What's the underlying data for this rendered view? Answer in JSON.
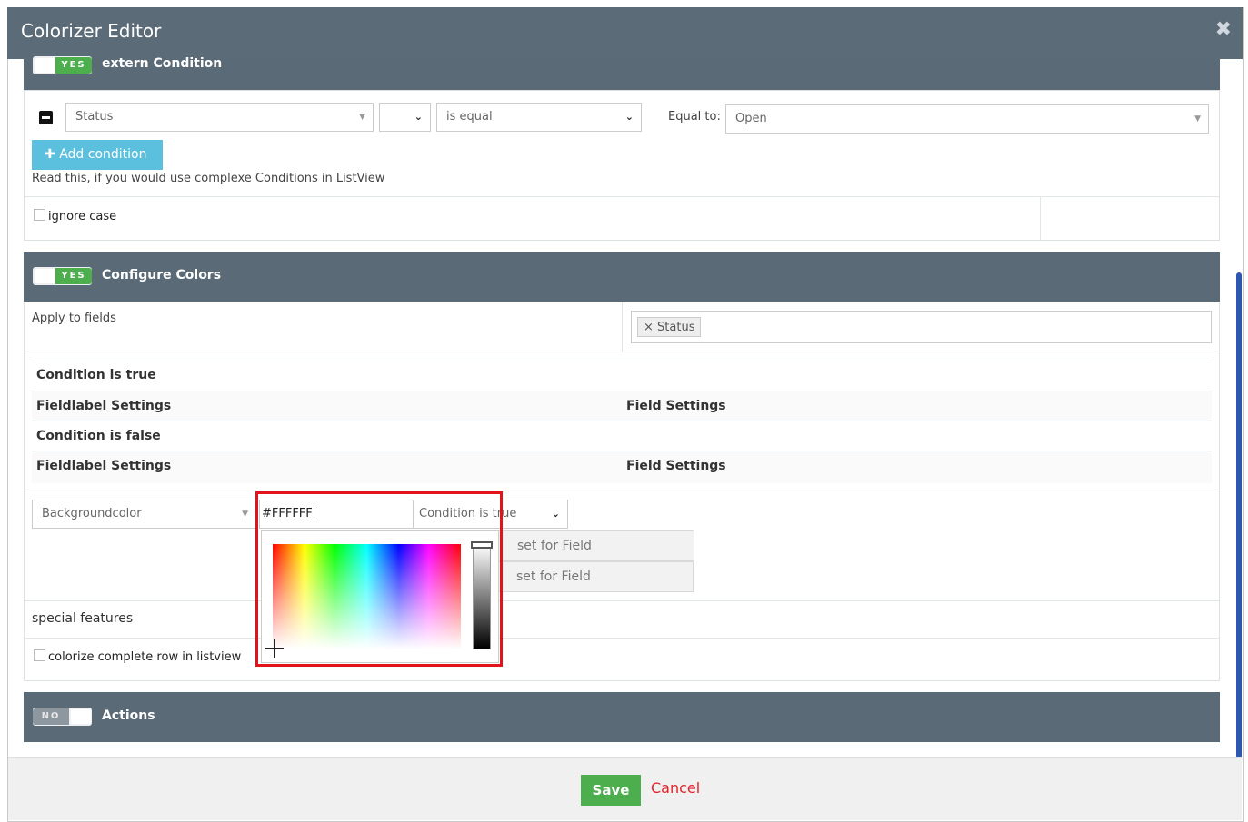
{
  "window": {
    "title": "Colorizer Editor",
    "close_icon": "close-icon"
  },
  "extern_section": {
    "toggle_label": "YES",
    "title": "extern Condition",
    "condition_row": {
      "field_value": "Status",
      "operator_select": "",
      "comparison_select": "is equal",
      "equal_to_label": "Equal to:",
      "equal_to_value": "Open"
    },
    "add_condition_label": "Add condition",
    "help_text": "Read this, if you would use complexe Conditions in ListView",
    "ignore_case_label": "ignore case"
  },
  "colors_section": {
    "toggle_label": "YES",
    "title": "Configure Colors",
    "apply_to_fields_label": "Apply to fields",
    "applied_tag": "Status",
    "rows": [
      {
        "left": "Condition is true",
        "right": ""
      },
      {
        "left": "Fieldlabel Settings",
        "right": "Field Settings"
      },
      {
        "left": "Condition is false",
        "right": ""
      },
      {
        "left": "Fieldlabel Settings",
        "right": "Field Settings"
      }
    ],
    "property_select": "Backgroundcolor",
    "color_input": "#FFFFFF",
    "condition_select": "Condition is true",
    "set_for_field_1": "set for Field",
    "set_for_field_2": "set for Field",
    "special_features_label": "special features",
    "colorize_row_label": "colorize complete row in listview"
  },
  "actions_section": {
    "toggle_label": "NO",
    "title": "Actions"
  },
  "footer": {
    "save_label": "Save",
    "cancel_label": "Cancel"
  },
  "colors": {
    "header_bg": "#5b6a77",
    "accent_blue": "#5bc0de",
    "save_green": "#4cae4c",
    "cancel_red": "#e0242a",
    "highlight_red": "#e3131b"
  }
}
